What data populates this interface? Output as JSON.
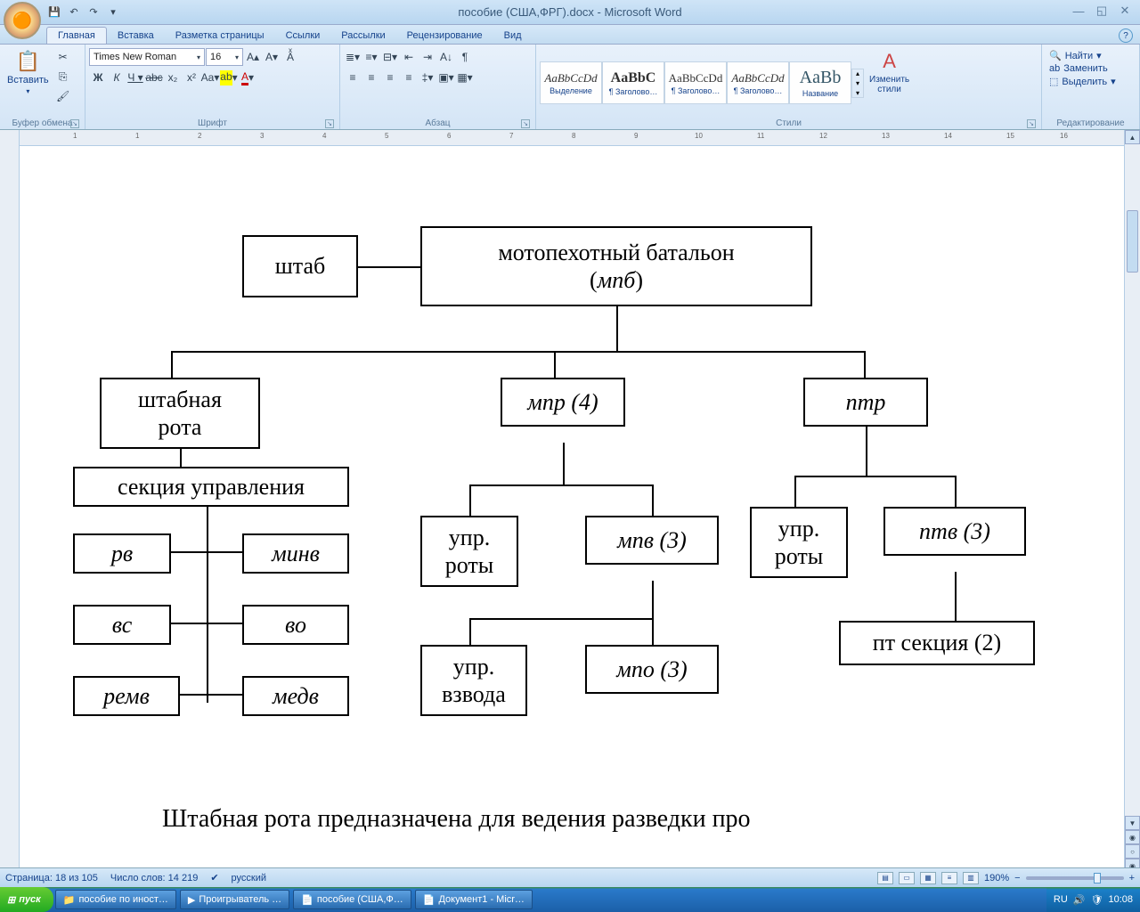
{
  "title": "пособие (США,ФРГ).docx - Microsoft Word",
  "qat": {
    "save": "💾",
    "undo": "↶",
    "redo": "↷"
  },
  "tabs": [
    "Главная",
    "Вставка",
    "Разметка страницы",
    "Ссылки",
    "Рассылки",
    "Рецензирование",
    "Вид"
  ],
  "ribbon": {
    "clipboard": {
      "label": "Буфер обмена",
      "paste": "Вставить"
    },
    "font": {
      "label": "Шрифт",
      "name": "Times New Roman",
      "size": "16"
    },
    "paragraph": {
      "label": "Абзац"
    },
    "styles": {
      "label": "Стили",
      "items": [
        {
          "preview": "AaBbCcDd",
          "name": "Выделение",
          "italic": true
        },
        {
          "preview": "AaBbC",
          "name": "¶ Заголово…",
          "bold": true
        },
        {
          "preview": "AaBbCcDd",
          "name": "¶ Заголово…"
        },
        {
          "preview": "AaBbCcDd",
          "name": "¶ Заголово…",
          "italic": true
        },
        {
          "preview": "AaBb",
          "name": "Название",
          "big": true
        }
      ],
      "change": "Изменить\nстили"
    },
    "editing": {
      "label": "Редактирование",
      "find": "Найти",
      "replace": "Заменить",
      "select": "Выделить"
    }
  },
  "diagram": {
    "hq": "штаб",
    "root_l1": "мотопехотный батальон",
    "root_l2": "(мпб)",
    "hq_co_l1": "штабная",
    "hq_co_l2": "рота",
    "mpr": "мпр (4)",
    "ptr": "птр",
    "sec_upr": "секция управления",
    "rv": "рв",
    "minv": "минв",
    "vs": "вс",
    "vo": "во",
    "remv": "ремв",
    "medv": "медв",
    "upr_roty_l1": "упр.",
    "upr_roty_l2": "роты",
    "mpv": "мпв (3)",
    "upr_vz_l1": "упр.",
    "upr_vz_l2": "взвода",
    "mpo": "мпо (3)",
    "ptv": "птв (3)",
    "pt_sec": "пт секция (2)",
    "footer": "Штабная рота предназначена для ведения разведки про"
  },
  "status": {
    "page": "Страница: 18 из 105",
    "words": "Число слов: 14 219",
    "lang": "русский",
    "zoom": "190%"
  },
  "taskbar": {
    "start": "пуск",
    "items": [
      "пособие по иност…",
      "Проигрыватель …",
      "пособие (США,Ф…",
      "Документ1 - Micr…"
    ],
    "lang": "RU",
    "time": "10:08"
  }
}
